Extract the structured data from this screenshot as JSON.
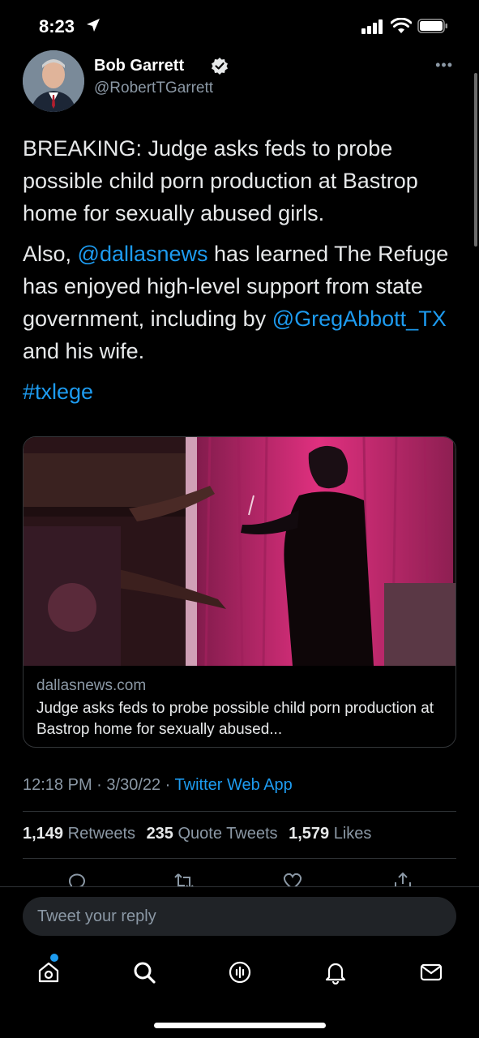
{
  "status_bar": {
    "time": "8:23"
  },
  "tweet": {
    "author_name": "Bob Garrett",
    "author_handle": "@RobertTGarrett",
    "paragraph1": "BREAKING: Judge asks feds to probe possible child porn production at Bastrop home for sexually abused girls.",
    "p2_part1": "Also, ",
    "p2_mention1": "@dallasnews",
    "p2_part2": " has learned The Refuge has enjoyed high-level support from state government, including by ",
    "p2_mention2": "@GregAbbott_TX",
    "p2_part3": " and his wife.",
    "hashtag": "#txlege",
    "time": "12:18 PM",
    "date": "3/30/22",
    "source": "Twitter Web App",
    "separator": " · "
  },
  "card": {
    "domain": "dallasnews.com",
    "title": "Judge asks feds to probe possible child porn production at Bastrop home for sexually abused..."
  },
  "stats": {
    "retweets_count": "1,149",
    "retweets_label": "Retweets",
    "quotes_count": "235",
    "quotes_label": "Quote Tweets",
    "likes_count": "1,579",
    "likes_label": "Likes"
  },
  "reply": {
    "placeholder": "Tweet your reply"
  },
  "colors": {
    "accent": "#1d9bf0",
    "background": "#000000",
    "muted": "#8b98a5"
  },
  "icons": [
    "location-arrow-icon",
    "signal-icon",
    "wifi-icon",
    "battery-icon",
    "verified-badge-icon",
    "more-icon",
    "reply-icon",
    "retweet-icon",
    "like-icon",
    "share-icon",
    "home-icon",
    "search-icon",
    "spaces-icon",
    "bell-icon",
    "mail-icon"
  ]
}
